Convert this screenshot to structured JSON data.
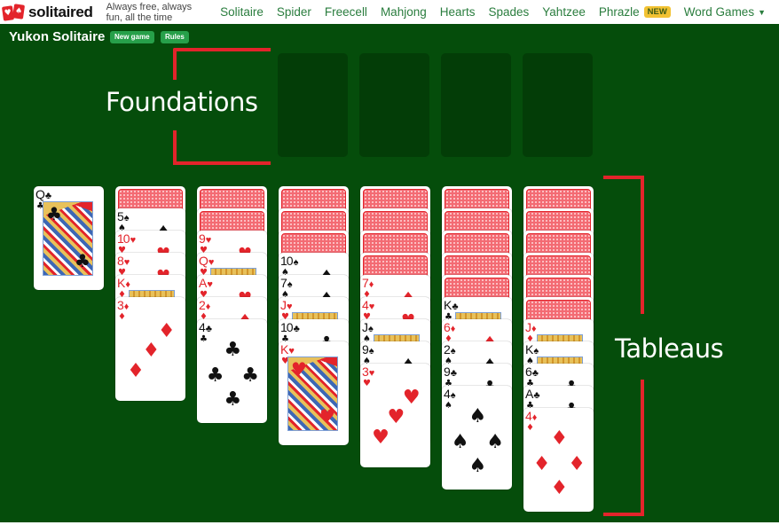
{
  "nav": {
    "logo_text": "solitaired",
    "tagline": "Always free, always fun, all the time",
    "links": [
      {
        "label": "Solitaire"
      },
      {
        "label": "Spider"
      },
      {
        "label": "Freecell"
      },
      {
        "label": "Mahjong"
      },
      {
        "label": "Hearts"
      },
      {
        "label": "Spades"
      },
      {
        "label": "Yahtzee"
      },
      {
        "label": "Phrazle",
        "badge": "NEW"
      },
      {
        "label": "Word Games",
        "dropdown": true
      }
    ]
  },
  "game": {
    "title": "Yukon Solitaire",
    "new_game_label": "New game",
    "rules_label": "Rules"
  },
  "annotations": {
    "foundations": "Foundations",
    "tableaus": "Tableaus"
  },
  "colors": {
    "felt": "#054d0b",
    "foundation_slot": "#033d07",
    "accent_red": "#e3242b",
    "nav_link": "#2a7d3e",
    "button": "#27a04a",
    "badge": "#f2c233"
  },
  "foundations": [
    {
      "cards": []
    },
    {
      "cards": []
    },
    {
      "cards": []
    },
    {
      "cards": []
    }
  ],
  "tableau": [
    {
      "face_down": 0,
      "face_up": [
        {
          "rank": "Q",
          "suit": "♣"
        }
      ]
    },
    {
      "face_down": 1,
      "face_up": [
        {
          "rank": "5",
          "suit": "♠"
        },
        {
          "rank": "10",
          "suit": "♥"
        },
        {
          "rank": "8",
          "suit": "♥"
        },
        {
          "rank": "K",
          "suit": "♦"
        },
        {
          "rank": "3",
          "suit": "♦"
        }
      ]
    },
    {
      "face_down": 2,
      "face_up": [
        {
          "rank": "9",
          "suit": "♥"
        },
        {
          "rank": "Q",
          "suit": "♥"
        },
        {
          "rank": "A",
          "suit": "♥"
        },
        {
          "rank": "2",
          "suit": "♦"
        },
        {
          "rank": "4",
          "suit": "♣"
        }
      ]
    },
    {
      "face_down": 3,
      "face_up": [
        {
          "rank": "10",
          "suit": "♠"
        },
        {
          "rank": "7",
          "suit": "♠"
        },
        {
          "rank": "J",
          "suit": "♥"
        },
        {
          "rank": "10",
          "suit": "♣"
        },
        {
          "rank": "K",
          "suit": "♥"
        }
      ]
    },
    {
      "face_down": 4,
      "face_up": [
        {
          "rank": "7",
          "suit": "♦"
        },
        {
          "rank": "4",
          "suit": "♥"
        },
        {
          "rank": "J",
          "suit": "♠"
        },
        {
          "rank": "9",
          "suit": "♠"
        },
        {
          "rank": "3",
          "suit": "♥"
        }
      ]
    },
    {
      "face_down": 5,
      "face_up": [
        {
          "rank": "K",
          "suit": "♣"
        },
        {
          "rank": "6",
          "suit": "♦"
        },
        {
          "rank": "2",
          "suit": "♠"
        },
        {
          "rank": "9",
          "suit": "♣"
        },
        {
          "rank": "4",
          "suit": "♠"
        }
      ]
    },
    {
      "face_down": 6,
      "face_up": [
        {
          "rank": "J",
          "suit": "♦"
        },
        {
          "rank": "K",
          "suit": "♠"
        },
        {
          "rank": "6",
          "suit": "♣"
        },
        {
          "rank": "A",
          "suit": "♣"
        },
        {
          "rank": "4",
          "suit": "♦"
        }
      ]
    }
  ]
}
